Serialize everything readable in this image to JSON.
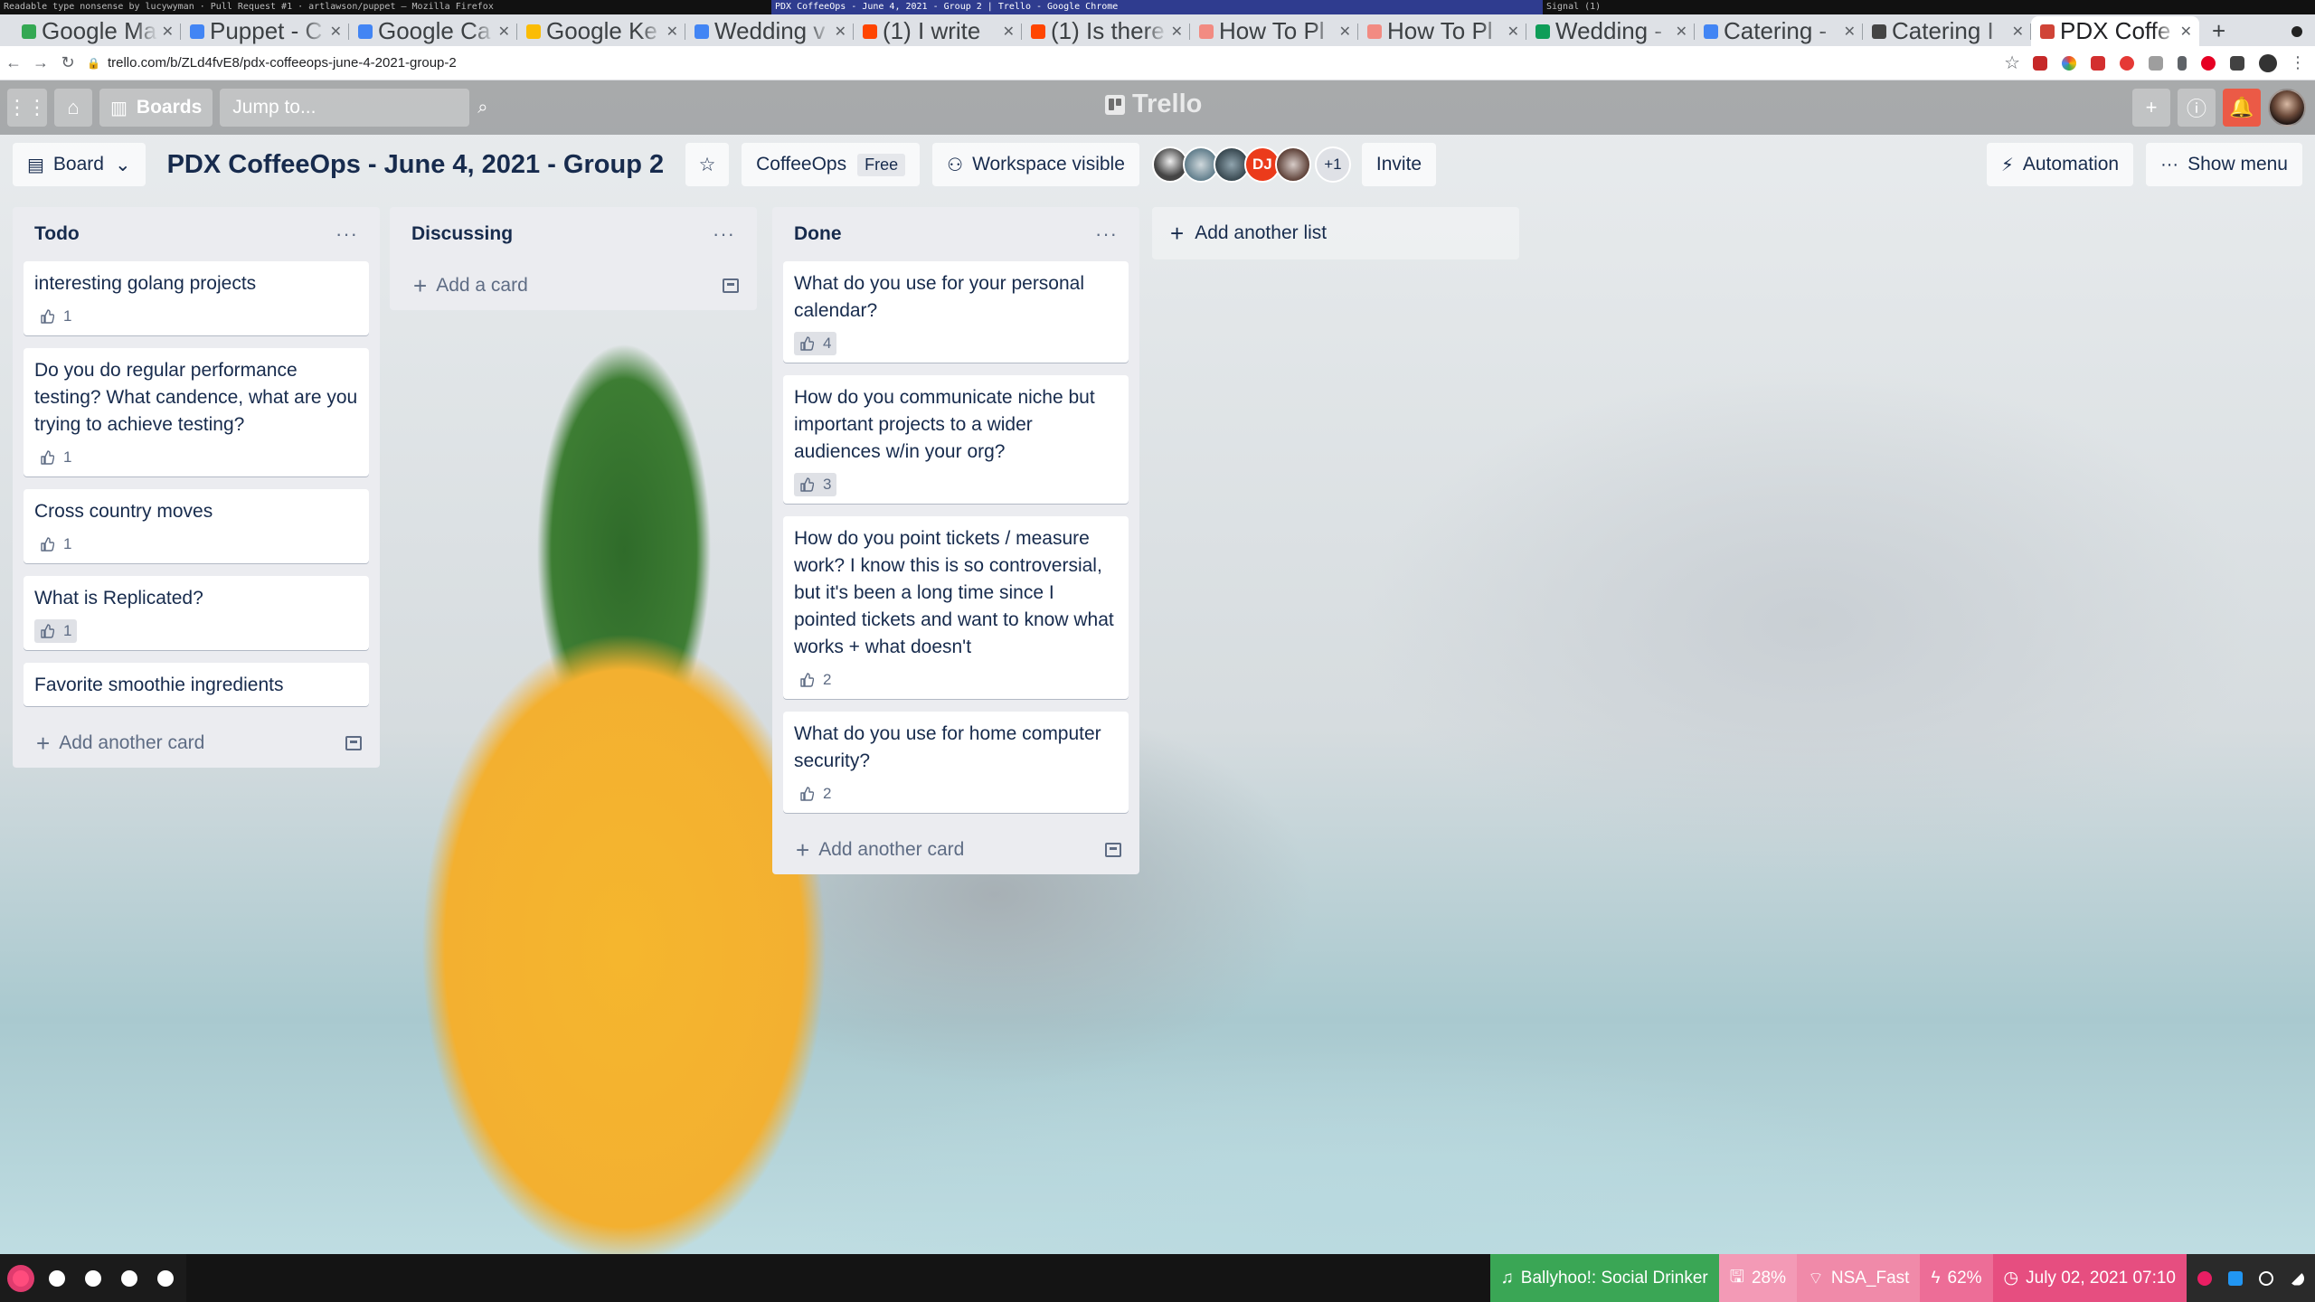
{
  "wm_titles": [
    "Readable type nonsense by lucywyman · Pull Request #1 · artlawson/puppet — Mozilla Firefox",
    "PDX CoffeeOps - June 4, 2021 - Group 2 | Trello - Google Chrome",
    "Signal (1)"
  ],
  "tabs": [
    {
      "label": "Google Maps",
      "color": "#34a853"
    },
    {
      "label": "Puppet - C",
      "color": "#4285f4"
    },
    {
      "label": "Google Ca",
      "color": "#4285f4"
    },
    {
      "label": "Google Ke",
      "color": "#fbbc04"
    },
    {
      "label": "Wedding v",
      "color": "#4285f4"
    },
    {
      "label": "(1) I write",
      "color": "#ff4500"
    },
    {
      "label": "(1) Is there",
      "color": "#ff4500"
    },
    {
      "label": "How To Pl",
      "color": "#f28b82"
    },
    {
      "label": "How To Pl",
      "color": "#f28b82"
    },
    {
      "label": "Wedding -",
      "color": "#0f9d58"
    },
    {
      "label": "Catering -",
      "color": "#4285f4"
    },
    {
      "label": "Catering I",
      "color": "#444444"
    },
    {
      "label": "PDX Coffe",
      "color": "#d04437",
      "active": true
    }
  ],
  "url": "trello.com/b/ZLd4fvE8/pdx-coffeeops-june-4-2021-group-2",
  "header": {
    "boards_label": "Boards",
    "search_placeholder": "Jump to...",
    "logo": "Trello"
  },
  "board": {
    "view_label": "Board",
    "title": "PDX CoffeeOps - June 4, 2021 - Group 2",
    "workspace": "CoffeeOps",
    "plan": "Free",
    "visibility": "Workspace visible",
    "member_initials": "DJ",
    "member_more": "+1",
    "invite": "Invite",
    "automation": "Automation",
    "show_menu": "Show menu"
  },
  "lists": [
    {
      "title": "Todo",
      "cards": [
        {
          "title": "interesting golang projects",
          "votes": "1"
        },
        {
          "title": "Do you do regular performance testing? What candence, what are you trying to achieve testing?",
          "votes": "1"
        },
        {
          "title": "Cross country moves",
          "votes": "1"
        },
        {
          "title": "What is Replicated?",
          "votes": "1",
          "voted": true
        },
        {
          "title": "Favorite smoothie ingredients"
        }
      ],
      "add_label": "Add another card"
    },
    {
      "title": "Discussing",
      "cards": [],
      "add_label": "Add a card"
    },
    {
      "title": "Done",
      "cards": [
        {
          "title": "What do you use for your personal calendar?",
          "votes": "4",
          "voted": true
        },
        {
          "title": "How do you communicate niche but important projects to a wider audiences w/in your org?",
          "votes": "3",
          "voted": true
        },
        {
          "title": "How do you point tickets / measure work? I know this is so controversial, but it's been a long time since I pointed tickets and want to know what works + what doesn't",
          "votes": "2"
        },
        {
          "title": "What do you use for home computer security?",
          "votes": "2"
        }
      ],
      "add_label": "Add another card"
    }
  ],
  "add_list_label": "Add another list",
  "statusbar": {
    "music": "Ballyhoo!: Social Drinker",
    "disk": "28%",
    "wifi": "NSA_Fast",
    "battery": "62%",
    "datetime": "July 02, 2021 07:10"
  },
  "colors": {
    "music_bg": "#3aa655",
    "disk_bg": "#f39ab6",
    "wifi_bg": "#f08aa9",
    "battery_bg": "#ed6d97",
    "clock_bg": "#e64e80"
  }
}
